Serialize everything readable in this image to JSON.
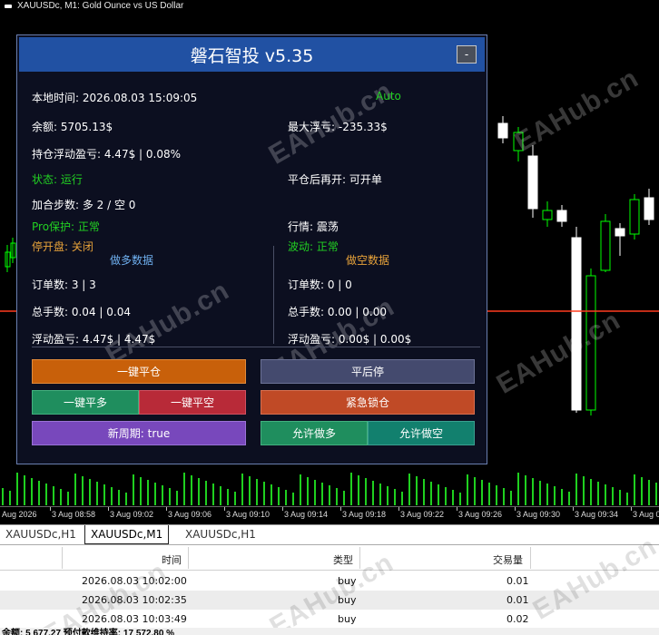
{
  "chart": {
    "title": "XAUUSDc, M1:  Gold Ounce vs US Dollar",
    "time_labels": [
      "Aug 2026",
      "3 Aug 08:58",
      "3 Aug 09:02",
      "3 Aug 09:06",
      "3 Aug 09:10",
      "3 Aug 09:14",
      "3 Aug 09:18",
      "3 Aug 09:22",
      "3 Aug 09:26",
      "3 Aug 09:30",
      "3 Aug 09:34",
      "3 Aug 0"
    ],
    "watermark": "EAHub.cn",
    "colors": {
      "background": "#000000",
      "bull": "#ffffff",
      "bear": "#00ff00",
      "price_line": "#ff3b1f",
      "volume": "#1fd01f"
    }
  },
  "panel": {
    "title": "磐石智投 v5.35",
    "minimize_label": "-",
    "local_time": "本地时间: 2026.08.03 15:09:05",
    "mode": "Auto",
    "balance": "余额: 5705.13$",
    "max_float_loss": "最大浮亏: -235.33$",
    "position_pnl": "持仓浮动盈亏: 4.47$ | 0.08%",
    "status": "状态: 运行",
    "reopen_after_close": "平仓后再开: 可开单",
    "add_steps": "加合步数: 多 2 / 空 0",
    "pro_protect": "Pro保护: 正常",
    "market": "行情: 震荡",
    "stop_open": "停开盘: 关闭",
    "volatility": "波动: 正常",
    "long_header": "做多数据",
    "short_header": "做空数据",
    "long_orders": "订单数: 3 | 3",
    "short_orders": "订单数: 0 | 0",
    "long_lots": "总手数: 0.04 | 0.04",
    "short_lots": "总手数: 0.00 | 0.00",
    "long_pnl": "浮动盈亏: 4.47$ | 4.47$",
    "short_pnl": "浮动盈亏: 0.00$ | 0.00$",
    "buttons": {
      "close_all": "一键平仓",
      "stop_after_close": "平后停",
      "close_long": "一键平多",
      "close_short": "一键平空",
      "emergency_lock": "紧急锁仓",
      "new_cycle": "新周期: true",
      "allow_long": "允许做多",
      "allow_short": "允许做空"
    }
  },
  "tabs": [
    {
      "label": "XAUUSDc,H1"
    },
    {
      "label": "XAUUSDc,M1"
    },
    {
      "label": "XAUUSDc,H1"
    }
  ],
  "table": {
    "headers": {
      "time": "时间",
      "type": "类型",
      "volume": "交易量"
    },
    "rows": [
      {
        "time": "2026.08.03 10:02:00",
        "type": "buy",
        "volume": "0.01"
      },
      {
        "time": "2026.08.03 10:02:35",
        "type": "buy",
        "volume": "0.01"
      },
      {
        "time": "2026.08.03 10:03:49",
        "type": "buy",
        "volume": "0.02"
      }
    ]
  },
  "status_bar": "余额: 5 677.27   预付款维持率: 17 572.80 %"
}
